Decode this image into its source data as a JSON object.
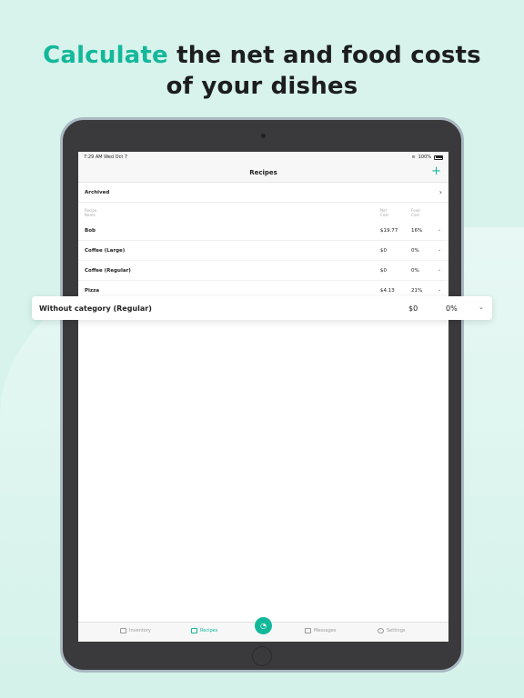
{
  "headline": {
    "accent": "Calculate",
    "rest_line1": " the net and food costs",
    "line2": "of your dishes"
  },
  "status": {
    "time": "7:29 AM",
    "date": "Wed Oct 7",
    "battery": "100%"
  },
  "nav": {
    "title": "Recipes",
    "add": "+"
  },
  "archived": {
    "label": "Archived",
    "chevron": "›"
  },
  "columns": {
    "name": "Recipe\nName",
    "net": "Net\nCost",
    "food": "Food\nCost"
  },
  "recipes": [
    {
      "name": "Bob",
      "net": "$19.77",
      "food": "16%"
    },
    {
      "name": "Coffee (Large)",
      "net": "$0",
      "food": "0%"
    },
    {
      "name": "Coffee (Regular)",
      "net": "$0",
      "food": "0%"
    },
    {
      "name": "Pizza",
      "net": "$4.13",
      "food": "21%"
    }
  ],
  "highlight": {
    "name": "Without category (Regular)",
    "net": "$0",
    "food": "0%"
  },
  "tabs": {
    "inventory": "Inventory",
    "recipes": "Recipes",
    "messages": "Messages",
    "settings": "Settings"
  },
  "colors": {
    "accent": "#13b89a",
    "background": "#d7f3ec",
    "tablet": "#3a3a3c"
  }
}
